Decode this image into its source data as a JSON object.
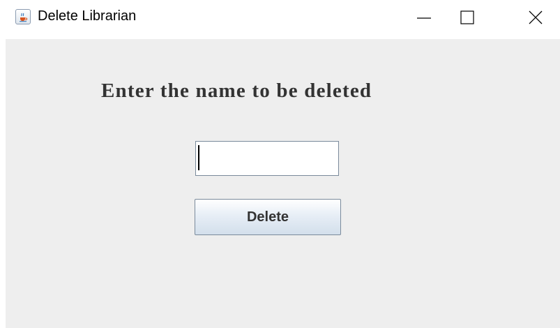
{
  "window": {
    "title": "Delete Librarian",
    "icon": "java-cup-icon",
    "controls": {
      "minimize": "minimize-icon",
      "maximize": "maximize-icon",
      "close": "close-icon"
    }
  },
  "form": {
    "heading": "Enter the name to be deleted",
    "name_value": "",
    "delete_label": "Delete"
  },
  "colors": {
    "content_background": "#eeeeee",
    "heading_text": "#333333",
    "button_gradient_top": "#ffffff",
    "button_gradient_bottom": "#d3dfeb"
  }
}
